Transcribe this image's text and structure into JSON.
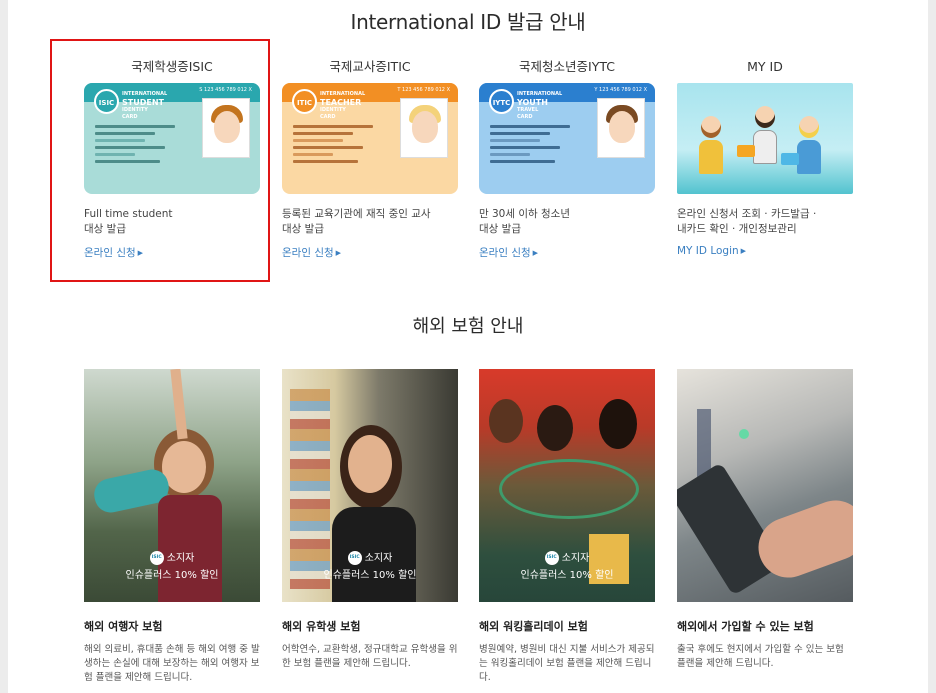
{
  "id_section": {
    "title": "International ID 발급 안내",
    "cards": [
      {
        "title": "국제학생증ISIC",
        "logo": "ISIC",
        "word_top": "INTERNATIONAL",
        "word_main": "STUDENT",
        "word_sub": "IDENTITY CARD",
        "number": "S 123 456 789 012 X",
        "desc1": "Full time student",
        "desc2": "대상 발급",
        "link": "온라인 신청"
      },
      {
        "title": "국제교사증ITIC",
        "logo": "ITIC",
        "word_top": "INTERNATIONAL",
        "word_main": "TEACHER",
        "word_sub": "IDENTITY CARD",
        "number": "T 123 456 789 012 X",
        "desc1": "등록된 교육기관에 재직 중인 교사",
        "desc2": "대상 발급",
        "link": "온라인 신청"
      },
      {
        "title": "국제청소년증IYTC",
        "logo": "IYTC",
        "word_top": "INTERNATIONAL",
        "word_main": "YOUTH",
        "word_sub": "TRAVEL CARD",
        "number": "Y 123 456 789 012 X",
        "desc1": "만 30세 이하 청소년",
        "desc2": "대상 발급",
        "link": "온라인 신청"
      },
      {
        "title": "MY ID",
        "desc1": "온라인 신청서 조회 · 카드발급 ·",
        "desc2": "내카드 확인 · 개인정보관리",
        "link": "MY ID Login"
      }
    ],
    "colors": {
      "isic_bg": "#a9dcd8",
      "isic_accent": "#2aa7ae",
      "itic_bg": "#fbd8a3",
      "itic_accent": "#f28f24",
      "iytc_bg": "#9dcdf0",
      "iytc_accent": "#2b7fcf"
    }
  },
  "insurance_section": {
    "title": "해외 보험 안내",
    "badge_icon": "ISIC",
    "items": [
      {
        "title": "해외 여행자 보험",
        "badge1": "소지자",
        "badge2": "인슈플러스 10% 할인",
        "desc": "해외 의료비, 휴대품 손해 등 해외 여행 중 발생하는 손실에 대해 보장하는 해외 여행자 보험 플랜을 제안해 드립니다."
      },
      {
        "title": "해외 유학생 보험",
        "badge1": "소지자",
        "badge2": "인슈플러스 10% 할인",
        "desc": "어학연수, 교환학생, 정규대학교 유학생을 위한 보험 플랜을 제안해 드립니다."
      },
      {
        "title": "해외 워킹홀리데이 보험",
        "badge1": "소지자",
        "badge2": "인슈플러스 10% 할인",
        "desc": "병원예약, 병원비 대신 지불 서비스가 제공되는 워킹홀리데이 보험 플랜을 제안해 드립니다."
      },
      {
        "title": "해외에서 가입할 수 있는 보험",
        "badge1": "",
        "badge2": "",
        "desc": "출국 후에도 현지에서 가입할 수 있는 보험 플랜을 제안해 드립니다."
      }
    ]
  }
}
